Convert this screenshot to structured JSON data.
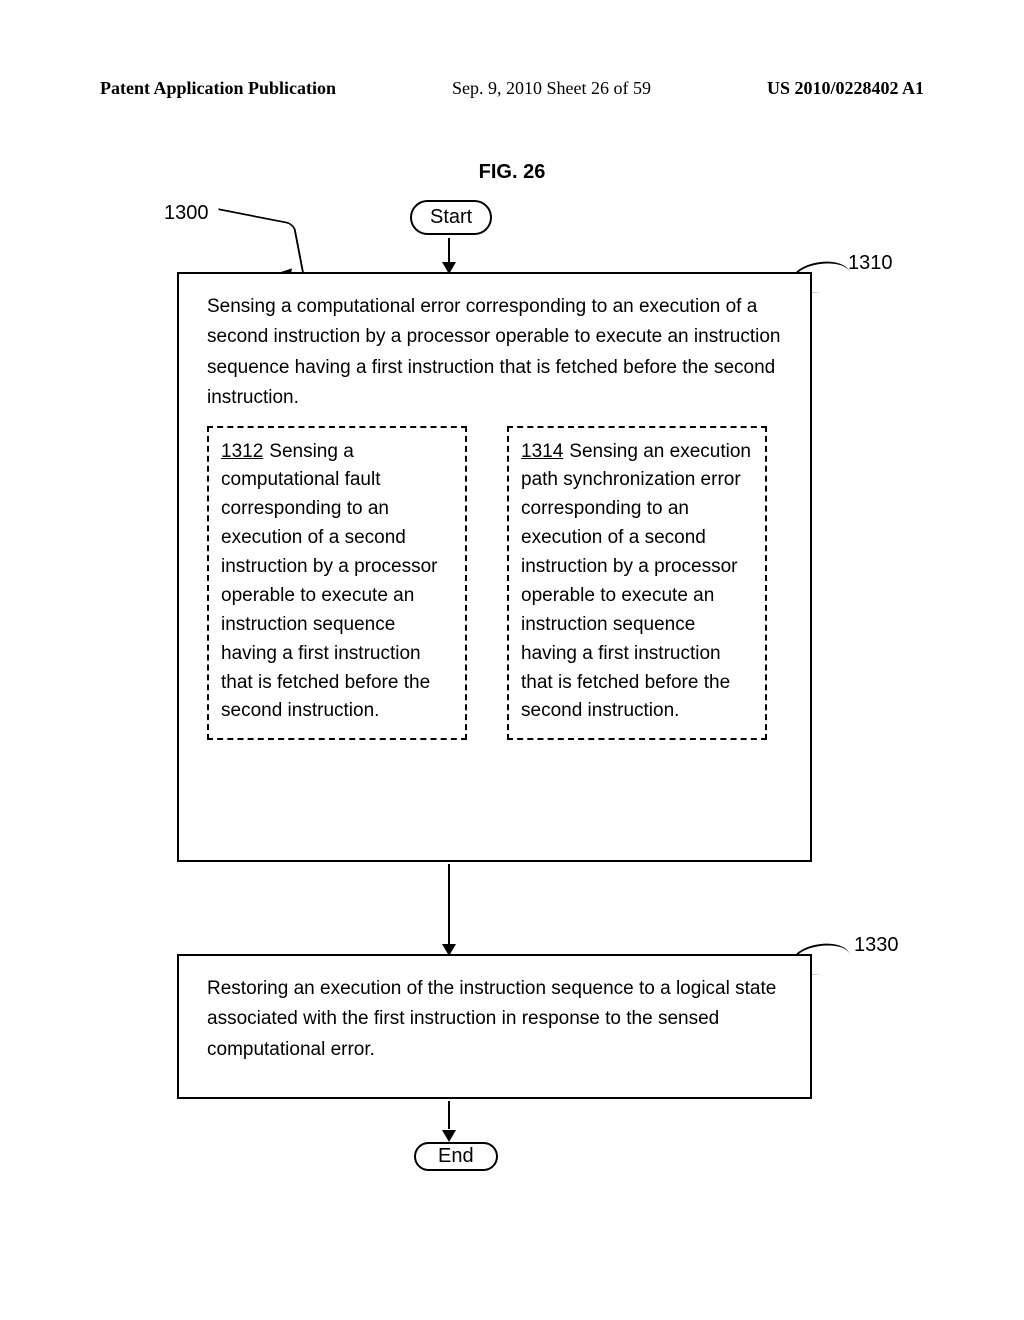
{
  "header": {
    "left": "Patent Application Publication",
    "mid": "Sep. 9, 2010  Sheet 26 of 59",
    "right": "US 2010/0228402 A1"
  },
  "figure": {
    "label": "FIG. 26",
    "start": "Start",
    "end": "End",
    "ref_1300": "1300",
    "ref_1310": "1310",
    "ref_1330": "1330",
    "box1310_text": "Sensing a computational error corresponding to an execution of a second instruction by a processor operable to execute an instruction sequence having a first instruction that is fetched before the second instruction.",
    "sub1312_ref": "1312",
    "sub1312_text": "Sensing a computational fault corresponding to an execution of a second instruction by a processor operable to execute an instruction sequence having a first instruction that is fetched before the second instruction.",
    "sub1314_ref": "1314",
    "sub1314_text": "Sensing an execution path synchronization error corresponding to an execution of a second instruction by a processor operable to execute an instruction sequence having a first instruction that is fetched before the second instruction.",
    "box1330_text": "Restoring an execution of the instruction sequence to a logical state associated with the first instruction in response to the sensed computational error."
  }
}
